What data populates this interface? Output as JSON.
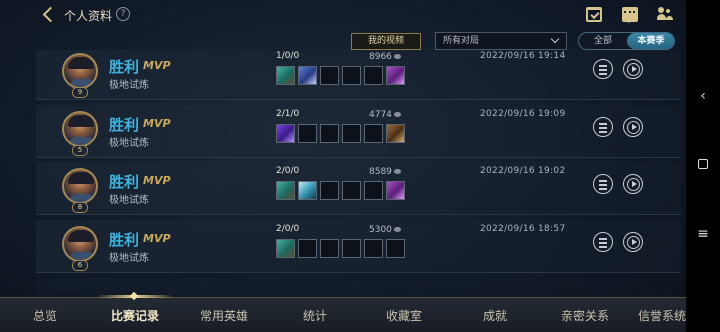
{
  "header": {
    "title": "个人资料",
    "help_icon": "?"
  },
  "filters": {
    "my_videos_label": "我的视频",
    "match_type_value": "所有对局",
    "segment_all": "全部",
    "segment_season": "本赛季"
  },
  "matches": [
    {
      "result": "胜利",
      "mvp": "MVP",
      "mode": "极地试炼",
      "level": "9",
      "kda": "1/0/0",
      "gold": "8966",
      "datetime": "2022/09/16 19:14",
      "items": [
        "it-green",
        "it-blue",
        "",
        "",
        "",
        "it-purple"
      ]
    },
    {
      "result": "胜利",
      "mvp": "MVP",
      "mode": "极地试炼",
      "level": "5",
      "kda": "2/1/0",
      "gold": "4774",
      "datetime": "2022/09/16 19:09",
      "items": [
        "it-violet",
        "",
        "",
        "",
        "",
        "it-brown"
      ]
    },
    {
      "result": "胜利",
      "mvp": "MVP",
      "mode": "极地试炼",
      "level": "8",
      "kda": "2/0/0",
      "gold": "8589",
      "datetime": "2022/09/16 19:02",
      "items": [
        "it-green",
        "it-cyan",
        "",
        "",
        "",
        "it-purple"
      ]
    },
    {
      "result": "胜利",
      "mvp": "MVP",
      "mode": "极地试炼",
      "level": "6",
      "kda": "2/0/0",
      "gold": "5300",
      "datetime": "2022/09/16 18:57",
      "items": [
        "it-green",
        "",
        "",
        "",
        "",
        ""
      ]
    }
  ],
  "nav": {
    "items": [
      "总览",
      "比赛记录",
      "常用英雄",
      "统计",
      "收藏室",
      "成就",
      "亲密关系",
      "信誉系统"
    ],
    "active_index": 1
  },
  "colors": {
    "accent_gold": "#c9b37e",
    "win_blue": "#3fb2de",
    "season_active": "#2f7898"
  }
}
